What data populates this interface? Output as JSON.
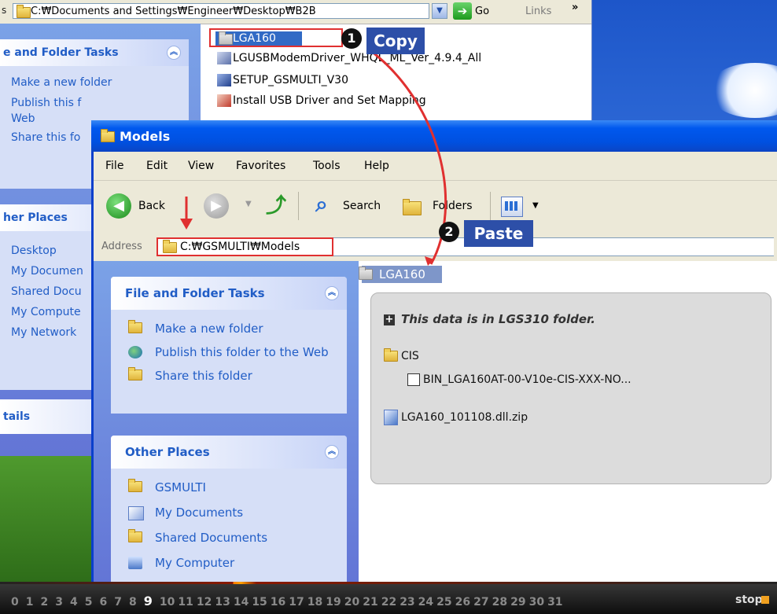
{
  "back_window": {
    "edge_char": "s",
    "address": "C:₩Documents and Settings₩Engineer₩Desktop₩B2B",
    "go_label": "Go",
    "links_label": "Links",
    "chevron": "»",
    "tasks_title": "e and Folder Tasks",
    "tasks_items": [
      "Make a new folder",
      "Publish this f",
      "Web",
      "Share this fo"
    ],
    "other_title": "her Places",
    "other_items": [
      "Desktop",
      "My Documen",
      "Shared Docu",
      "My Compute",
      "My Network"
    ],
    "details_title": "tails",
    "files": [
      {
        "name": "LGA160",
        "icon": "folder-icon"
      },
      {
        "name": "LGUSBModemDriver_WHQL_ML_Ver_4.9.4_All",
        "icon": "installer-icon"
      },
      {
        "name": "SETUP_GSMULTI_V30",
        "icon": "setup-icon"
      },
      {
        "name": "Install USB Driver and Set Mapping",
        "icon": "script-icon"
      }
    ]
  },
  "front_window": {
    "title": "Models",
    "menu": [
      "File",
      "Edit",
      "View",
      "Favorites",
      "Tools",
      "Help"
    ],
    "toolbar": {
      "back": "Back",
      "search": "Search",
      "folders": "Folders"
    },
    "address_label": "Address",
    "address": "C:₩GSMULTI₩Models",
    "tasks_title": "File and Folder Tasks",
    "tasks_items": [
      "Make a new folder",
      "Publish this folder to the Web",
      "Share this folder"
    ],
    "other_title": "Other Places",
    "other_items": [
      "GSMULTI",
      "My Documents",
      "Shared Documents",
      "My Computer"
    ],
    "pasted_folder": "LGA160"
  },
  "info": {
    "title": "This data is in LGS310 folder.",
    "folder": "CIS",
    "bin_file": "BIN_LGA160AT-00-V10e-CIS-XXX-NO...",
    "zip_file": "LGA160_101108.dll.zip"
  },
  "callouts": {
    "step1": "1",
    "step1_label": "Copy",
    "step2": "2",
    "step2_label": "Paste"
  },
  "bottom": {
    "pages": [
      "0",
      "1",
      "2",
      "3",
      "4",
      "5",
      "6",
      "7",
      "8",
      "9",
      "10",
      "11",
      "12",
      "13",
      "14",
      "15",
      "16",
      "17",
      "18",
      "19",
      "20",
      "21",
      "22",
      "23",
      "24",
      "25",
      "26",
      "27",
      "28",
      "29",
      "30",
      "31"
    ],
    "current_page": "9",
    "stop": "stop"
  },
  "colors": {
    "xp_blue": "#0058ee",
    "callout_red": "#e03030",
    "label_blue": "#2d4fa8"
  }
}
